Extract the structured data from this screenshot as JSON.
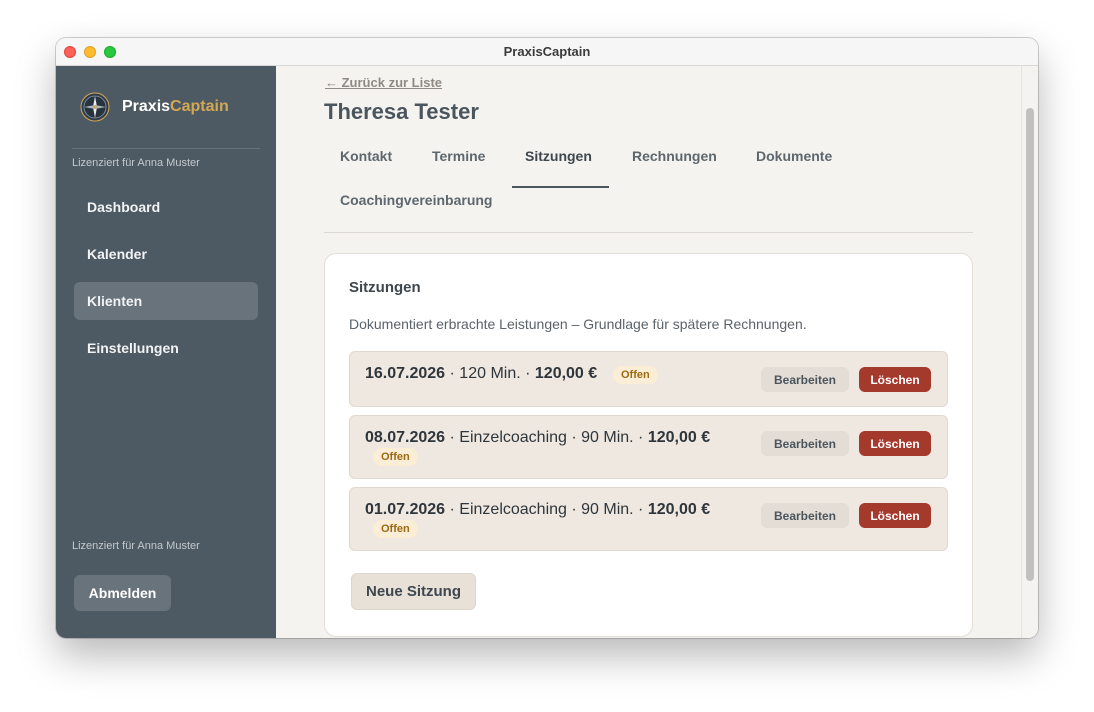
{
  "window": {
    "title": "PraxisCaptain"
  },
  "sidebar": {
    "brand_part1": "Praxis",
    "brand_part2": "Captain",
    "license_top": "Lizenziert für Anna Muster",
    "license_bottom": "Lizenziert für Anna Muster",
    "nav": [
      {
        "label": "Dashboard",
        "active": false
      },
      {
        "label": "Kalender",
        "active": false
      },
      {
        "label": "Klienten",
        "active": true
      },
      {
        "label": "Einstellungen",
        "active": false
      }
    ],
    "logout_label": "Abmelden"
  },
  "main": {
    "back_link": "← Zurück zur Liste",
    "client_name": "Theresa Tester",
    "tabs": [
      "Kontakt",
      "Termine",
      "Sitzungen",
      "Rechnungen",
      "Dokumente",
      "Coachingvereinbarung"
    ],
    "active_tab": "Sitzungen",
    "card": {
      "title": "Sitzungen",
      "description": "Dokumentiert erbrachte Leistungen – Grundlage für spätere Rechnungen.",
      "sessions": [
        {
          "date": "16.07.2026",
          "middle": " · 120 Min. · ",
          "amount": "120,00 €",
          "status": "Offen"
        },
        {
          "date": "08.07.2026",
          "middle": " · Einzelcoaching · 90 Min. · ",
          "amount": "120,00 €",
          "status": "Offen"
        },
        {
          "date": "01.07.2026",
          "middle": " · Einzelcoaching · 90 Min. · ",
          "amount": "120,00 €",
          "status": "Offen"
        }
      ],
      "edit_label": "Bearbeiten",
      "delete_label": "Löschen",
      "new_session_label": "Neue Sitzung"
    }
  },
  "colors": {
    "sidebar_bg": "#4e5a63",
    "brand_accent": "#d4a853",
    "delete_button": "#a33a2c",
    "badge_bg": "#fbedd6",
    "badge_text": "#9b6a14",
    "session_row_bg": "#efe8e0"
  }
}
